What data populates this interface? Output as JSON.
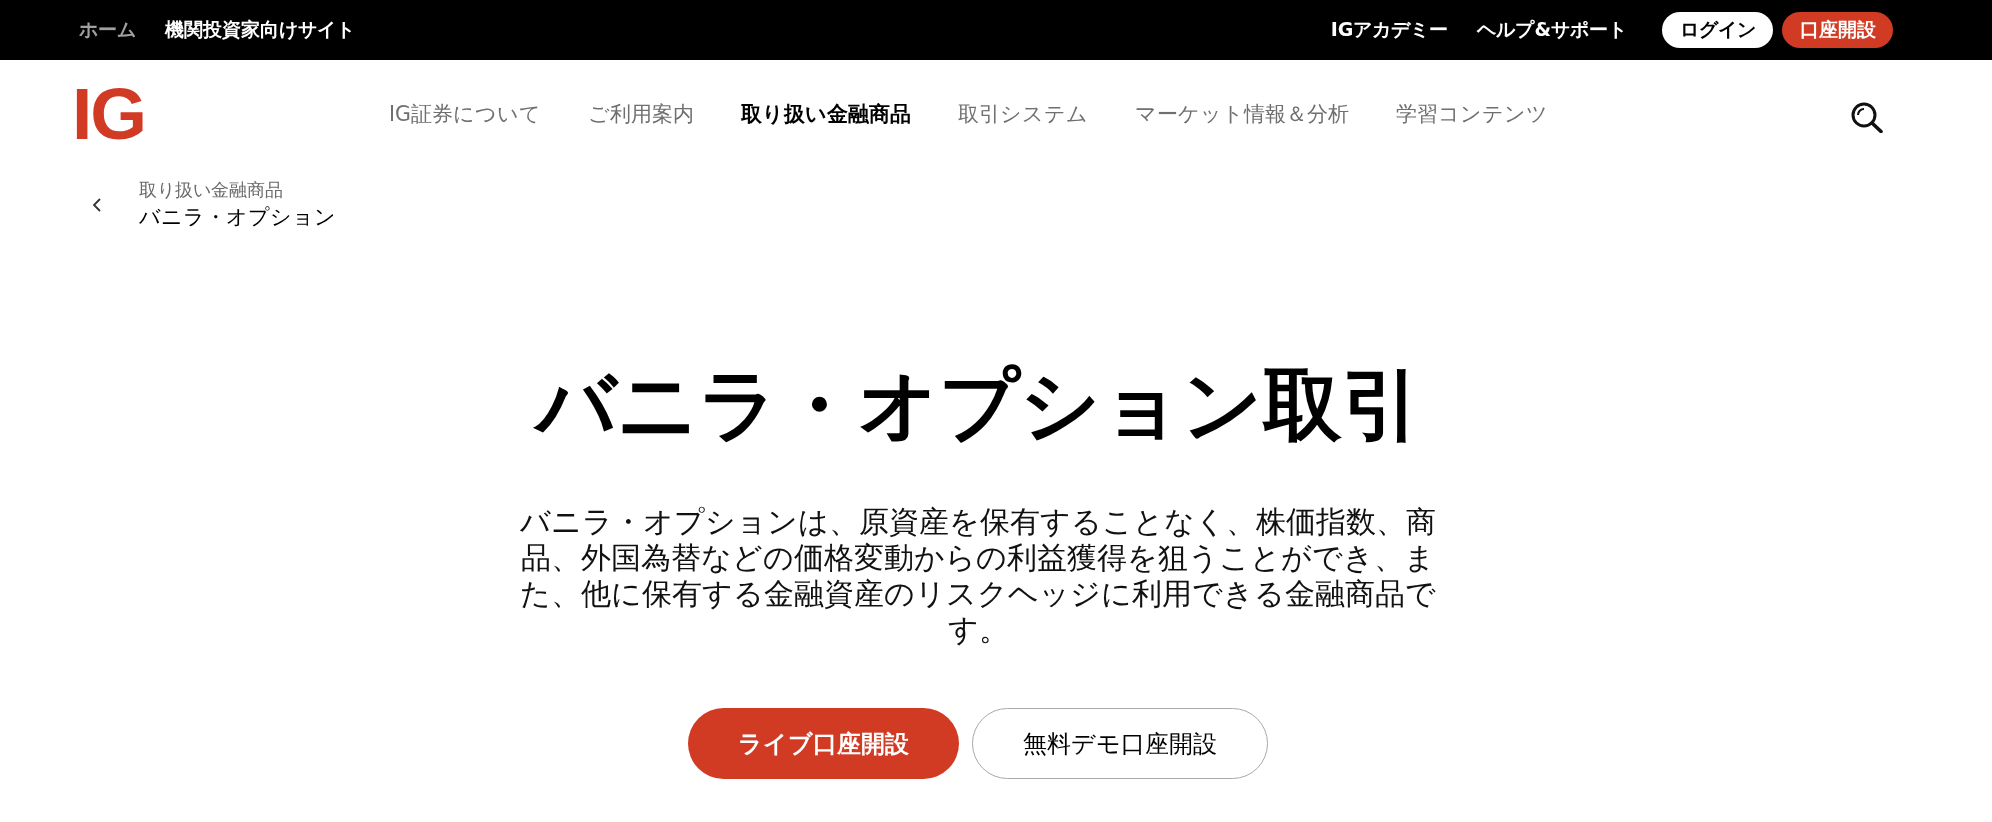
{
  "top_bar": {
    "left_links": [
      {
        "label": "ホーム",
        "selected": true
      },
      {
        "label": "機関投資家向けサイト",
        "selected": false
      }
    ],
    "right_links": [
      "IGアカデミー",
      "ヘルプ&サポート"
    ],
    "buttons": [
      {
        "label": "ログイン",
        "kind": "secondary"
      },
      {
        "label": "口座開設",
        "kind": "primary"
      }
    ]
  },
  "header": {
    "logo": "IG",
    "nav": [
      {
        "label": "IG証券について",
        "selected": false
      },
      {
        "label": "ご利用案内",
        "selected": false
      },
      {
        "label": "取り扱い金融商品",
        "selected": true
      },
      {
        "label": "取引システム",
        "selected": false
      },
      {
        "label": "マーケット情報＆分析",
        "selected": false
      },
      {
        "label": "学習コンテンツ",
        "selected": false
      }
    ]
  },
  "breadcrumb": {
    "parent": "取り扱い金融商品",
    "current": "バニラ・オプション"
  },
  "hero": {
    "title": "バニラ・オプション取引",
    "description": "バニラ・オプションは、原資産を保有することなく、株価指数、商品、外国為替などの価格変動からの利益獲得を狙うことができ、また、他に保有する金融資産のリスクヘッジに利用できる金融商品です。",
    "buttons": [
      {
        "label": "ライブ口座開設",
        "kind": "primary"
      },
      {
        "label": "無料デモ口座開設",
        "kind": "secondary"
      }
    ]
  }
}
